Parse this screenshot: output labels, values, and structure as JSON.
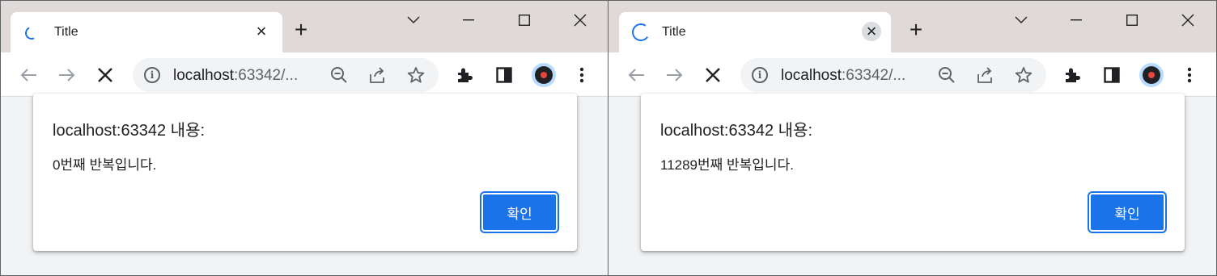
{
  "windows": [
    {
      "tab": {
        "title": "Title",
        "close_glyph": "×"
      },
      "newtab_glyph": "+",
      "omnibox": {
        "host": "localhost",
        "rest": ":63342/..."
      },
      "dialog": {
        "title": "localhost:63342 내용:",
        "message": "0번째 반복입니다.",
        "ok_label": "확인"
      }
    },
    {
      "tab": {
        "title": "Title",
        "close_glyph": "×"
      },
      "newtab_glyph": "+",
      "omnibox": {
        "host": "localhost",
        "rest": ":63342/..."
      },
      "dialog": {
        "title": "localhost:63342 내용:",
        "message": "11289번째 반복입니다.",
        "ok_label": "확인"
      }
    }
  ],
  "icons": [
    "tab-spinner-icon",
    "close-icon",
    "plus-icon",
    "chevron-down-icon",
    "minimize-icon",
    "maximize-icon",
    "close-window-icon",
    "back-arrow-icon",
    "forward-arrow-icon",
    "stop-icon",
    "info-icon",
    "zoom-out-icon",
    "share-icon",
    "star-icon",
    "extensions-icon",
    "side-panel-icon",
    "avatar-icon",
    "kebab-menu-icon"
  ],
  "colors": {
    "accent": "#1a73e8",
    "tabstrip": "#dfdad7",
    "page": "#f1f3f4"
  }
}
